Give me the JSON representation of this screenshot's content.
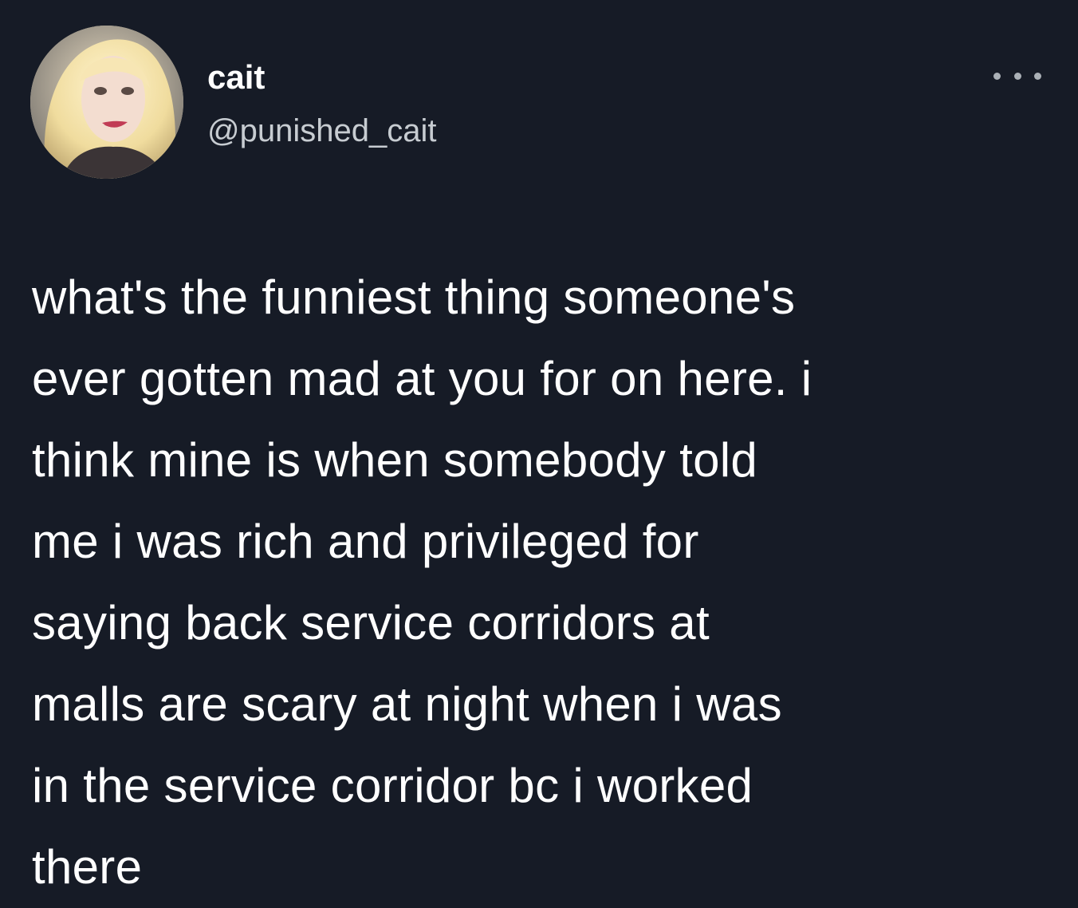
{
  "author": {
    "display_name": "cait",
    "handle": "@punished_cait",
    "avatar_icon": "profile-photo"
  },
  "menu": {
    "icon": "more-options-icon"
  },
  "tweet": {
    "text": "what's the funniest thing someone's\never gotten mad at you for on here. i\nthink mine is when somebody told\nme i was rich and privileged  for\nsaying back service corridors at\nmalls are scary at night when i was\nin the service corridor bc i worked\nthere"
  },
  "colors": {
    "background": "#161b26",
    "text": "#ffffff",
    "handle": "#c7ccd1"
  }
}
